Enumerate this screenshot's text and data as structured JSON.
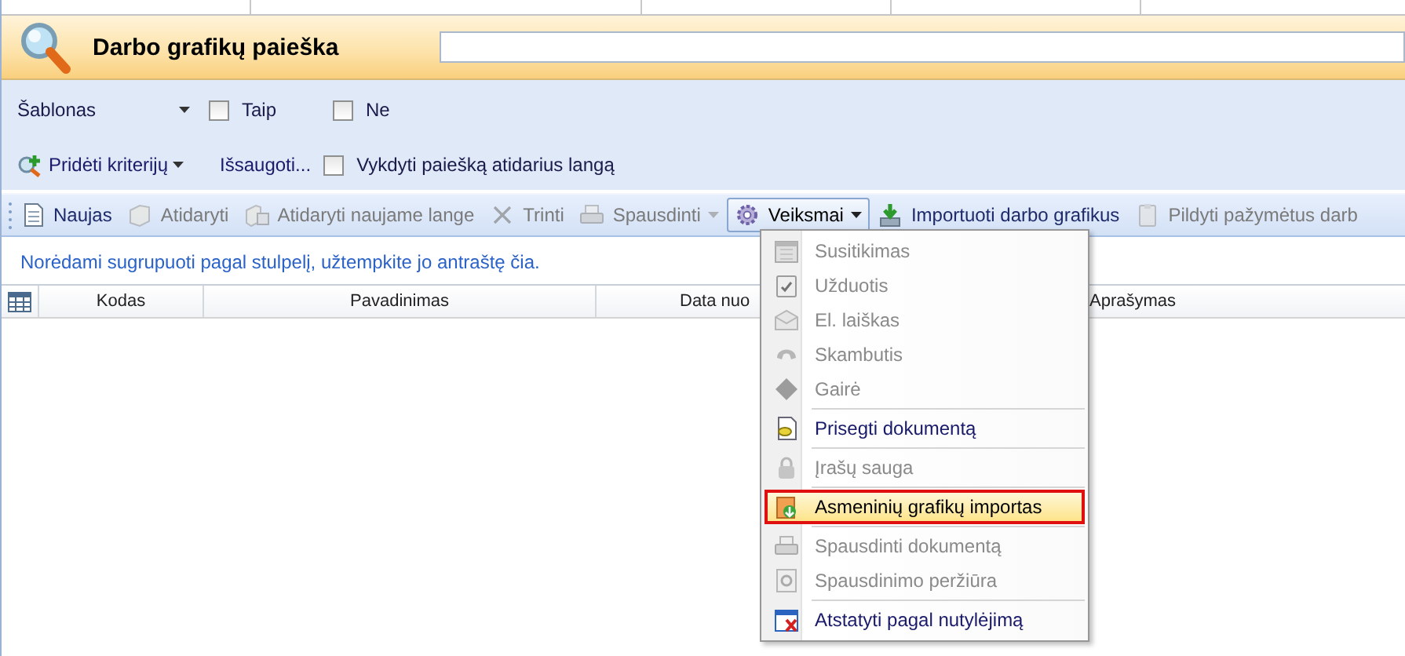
{
  "header": {
    "title": "Darbo grafikų paieška"
  },
  "criteria": {
    "template": {
      "label": "Šablonas"
    },
    "checkboxes": [
      {
        "label": "Taip",
        "checked": false
      },
      {
        "label": "Ne",
        "checked": false
      }
    ],
    "add_criteria": "Pridėti kriterijų",
    "save": "Išsaugoti...",
    "run_on_open": {
      "label": "Vykdyti paiešką atidarius langą",
      "checked": false
    }
  },
  "toolbar": [
    {
      "label": "Naujas",
      "disabled": false,
      "dropdown": false,
      "pressed": false
    },
    {
      "label": "Atidaryti",
      "disabled": true,
      "dropdown": false,
      "pressed": false
    },
    {
      "label": "Atidaryti naujame lange",
      "disabled": true,
      "dropdown": false,
      "pressed": false
    },
    {
      "label": "Trinti",
      "disabled": true,
      "dropdown": false,
      "pressed": false
    },
    {
      "label": "Spausdinti",
      "disabled": true,
      "dropdown": true,
      "pressed": false
    },
    {
      "label": "Veiksmai",
      "disabled": false,
      "dropdown": true,
      "pressed": true
    },
    {
      "label": "Importuoti darbo grafikus",
      "disabled": false,
      "dropdown": false,
      "pressed": false
    },
    {
      "label": "Pildyti pažymėtus darb",
      "disabled": true,
      "dropdown": false,
      "pressed": false
    }
  ],
  "group_hint": "Norėdami sugrupuoti pagal stulpelį, užtempkite jo antraštę čia.",
  "table": {
    "columns": [
      "Kodas",
      "Pavadinimas",
      "Data nuo",
      "Aprašymas"
    ]
  },
  "menu": [
    {
      "kind": "item",
      "label": "Susitikimas",
      "disabled": true,
      "selected": false
    },
    {
      "kind": "item",
      "label": "Užduotis",
      "disabled": true,
      "selected": false
    },
    {
      "kind": "item",
      "label": "El. laiškas",
      "disabled": true,
      "selected": false
    },
    {
      "kind": "item",
      "label": "Skambutis",
      "disabled": true,
      "selected": false
    },
    {
      "kind": "item",
      "label": "Gairė",
      "disabled": true,
      "selected": false
    },
    {
      "kind": "separator"
    },
    {
      "kind": "item",
      "label": "Prisegti dokumentą",
      "disabled": false,
      "selected": false
    },
    {
      "kind": "separator"
    },
    {
      "kind": "item",
      "label": "Įrašų sauga",
      "disabled": true,
      "selected": false
    },
    {
      "kind": "separator"
    },
    {
      "kind": "item",
      "label": "Asmeninių grafikų importas",
      "disabled": false,
      "selected": true
    },
    {
      "kind": "separator"
    },
    {
      "kind": "item",
      "label": "Spausdinti dokumentą",
      "disabled": true,
      "selected": false
    },
    {
      "kind": "item",
      "label": "Spausdinimo peržiūra",
      "disabled": true,
      "selected": false
    },
    {
      "kind": "separator"
    },
    {
      "kind": "item",
      "label": "Atstatyti pagal nutylėjimą",
      "disabled": false,
      "selected": false
    }
  ]
}
